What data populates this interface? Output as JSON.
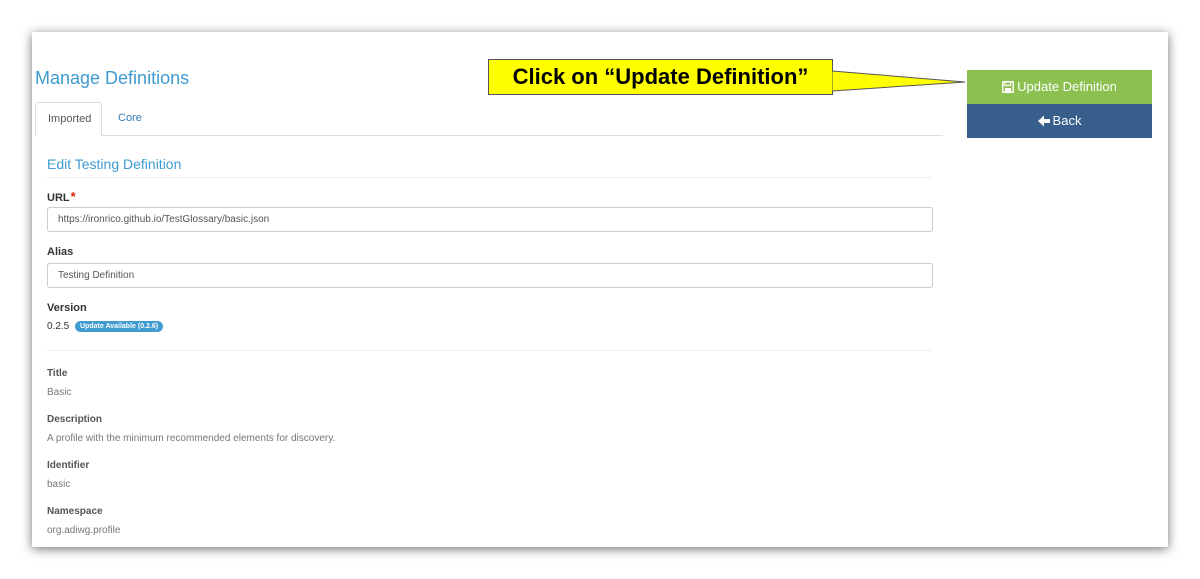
{
  "header": {
    "title": "Manage Definitions"
  },
  "tabs": [
    {
      "label": "Imported",
      "active": true
    },
    {
      "label": "Core",
      "active": false
    }
  ],
  "form": {
    "heading": "Edit Testing Definition",
    "url_label": "URL",
    "required_mark": "*",
    "url_value": "https://ironrico.github.io/TestGlossary/basic.json",
    "alias_label": "Alias",
    "alias_value": "Testing Definition",
    "version_label": "Version",
    "version_value": "0.2.5",
    "update_badge": "Update Available (0.2.6)"
  },
  "details": {
    "title_label": "Title",
    "title_value": "Basic",
    "description_label": "Description",
    "description_value": "A profile with the minimum recommended elements for discovery.",
    "identifier_label": "Identifier",
    "identifier_value": "basic",
    "namespace_label": "Namespace",
    "namespace_value": "org.adiwg.profile"
  },
  "actions": {
    "update_label": "Update Definition",
    "back_label": "Back"
  },
  "annotation": {
    "callout_text": "Click on “Update Definition”"
  },
  "icons": {
    "update": "save-icon",
    "back": "arrow-left-icon"
  },
  "colors": {
    "title_blue": "#3f9bd0",
    "update_green": "#8cc152",
    "back_blue": "#385f8c",
    "callout_yellow": "#ffff00"
  }
}
